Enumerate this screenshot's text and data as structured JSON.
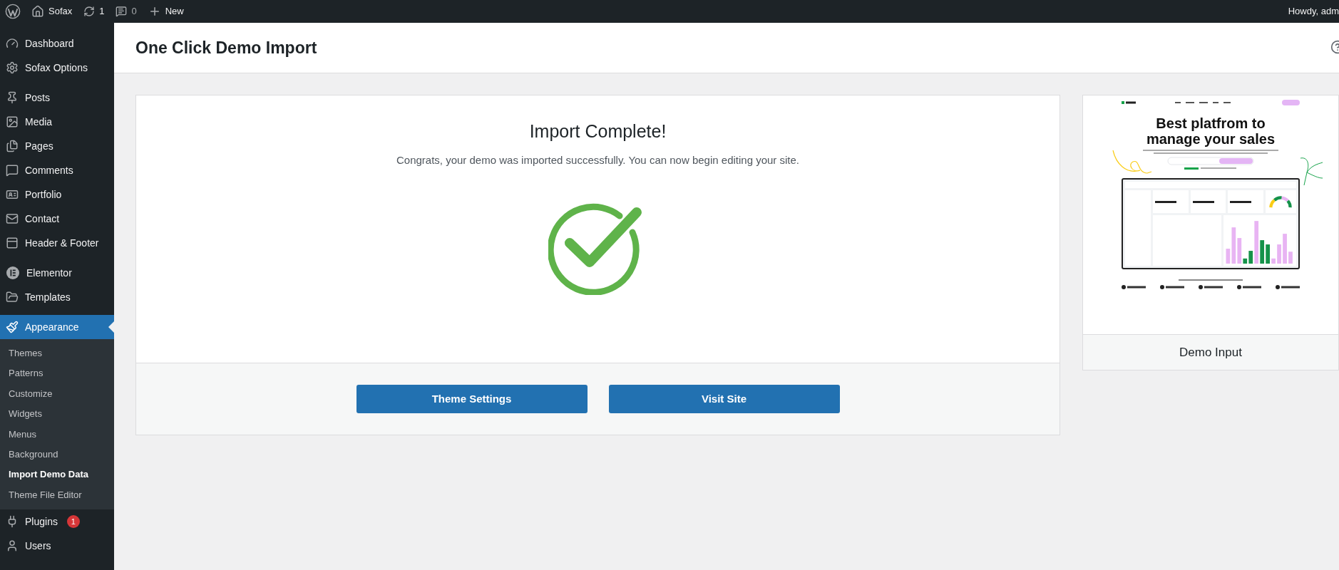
{
  "admin_bar": {
    "site_name": "Sofax",
    "updates_count": "1",
    "comments_count": "0",
    "new_label": "New",
    "greeting": "Howdy, adm"
  },
  "sidebar": {
    "groups": [
      {
        "items": [
          {
            "label": "Dashboard",
            "selected": false
          },
          {
            "label": "Sofax Options",
            "selected": false
          }
        ]
      },
      {
        "items": [
          {
            "label": "Posts",
            "selected": false
          },
          {
            "label": "Media",
            "selected": false
          },
          {
            "label": "Pages",
            "selected": false
          },
          {
            "label": "Comments",
            "selected": false
          },
          {
            "label": "Portfolio",
            "selected": false
          },
          {
            "label": "Contact",
            "selected": false
          },
          {
            "label": "Header & Footer",
            "selected": false
          }
        ]
      },
      {
        "items": [
          {
            "label": "Elementor",
            "selected": false
          },
          {
            "label": "Templates",
            "selected": false
          }
        ]
      },
      {
        "items": [
          {
            "label": "Appearance",
            "selected": true,
            "children": [
              {
                "label": "Themes",
                "selected": false
              },
              {
                "label": "Patterns",
                "selected": false
              },
              {
                "label": "Customize",
                "selected": false
              },
              {
                "label": "Widgets",
                "selected": false
              },
              {
                "label": "Menus",
                "selected": false
              },
              {
                "label": "Background",
                "selected": false
              },
              {
                "label": "Import Demo Data",
                "selected": true
              },
              {
                "label": "Theme File Editor",
                "selected": false
              }
            ]
          },
          {
            "label": "Plugins",
            "selected": false,
            "badge": "1"
          },
          {
            "label": "Users",
            "selected": false
          }
        ]
      }
    ]
  },
  "page": {
    "title": "One Click Demo Import"
  },
  "result": {
    "title": "Import Complete!",
    "message": "Congrats, your demo was imported successfully. You can now begin editing your site.",
    "buttons": [
      "Theme Settings",
      "Visit Site"
    ]
  },
  "preview": {
    "headline": "Best platfrom to manage your sales",
    "caption": "Demo Input"
  }
}
